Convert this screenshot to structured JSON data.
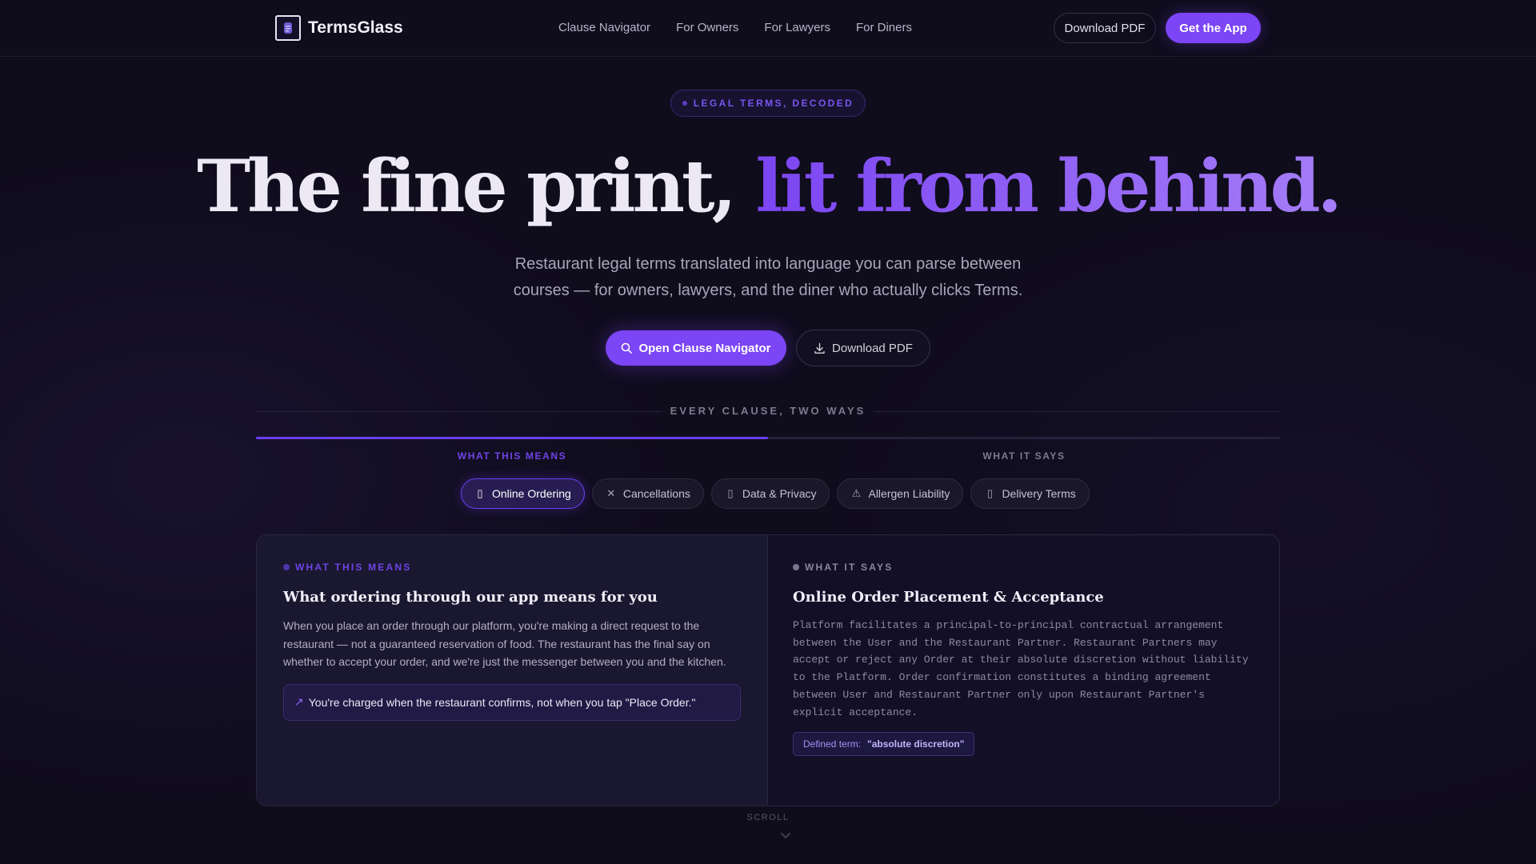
{
  "brand": {
    "name": "TermsGlass"
  },
  "nav": {
    "links": [
      "Clause Navigator",
      "For Owners",
      "For Lawyers",
      "For Diners"
    ],
    "download_label": "Download PDF",
    "get_app_label": "Get the App"
  },
  "hero": {
    "badge": "LEGAL TERMS, DECODED",
    "headline_plain": "The fine print, ",
    "headline_accent": "lit from behind.",
    "subtitle": "Restaurant legal terms translated into language you can parse between courses — for owners, lawyers, and the diner who actually clicks Terms.",
    "primary_cta": "Open Clause Navigator",
    "secondary_cta": "Download PDF"
  },
  "section": {
    "label": "EVERY CLAUSE, TWO WAYS",
    "progress": 0.5,
    "left_label": "WHAT THIS MEANS",
    "right_label": "WHAT IT SAYS"
  },
  "chips": [
    {
      "label": "Online Ordering",
      "icon": "receipt-icon",
      "active": true
    },
    {
      "label": "Cancellations",
      "icon": "close-icon",
      "active": false
    },
    {
      "label": "Data & Privacy",
      "icon": "lock-icon",
      "active": false
    },
    {
      "label": "Allergen Liability",
      "icon": "warning-icon",
      "active": false
    },
    {
      "label": "Delivery Terms",
      "icon": "truck-icon",
      "active": false
    }
  ],
  "panel": {
    "left": {
      "kicker": "WHAT THIS MEANS",
      "title": "What ordering through our app means for you",
      "body": "When you place an order through our platform, you're making a direct request to the restaurant — not a guaranteed reservation of food. The restaurant has the final say on whether to accept your order, and we're just the messenger between you and the kitchen.",
      "callout": "You're charged when the restaurant confirms, not when you tap \"Place Order.\""
    },
    "right": {
      "kicker": "WHAT IT SAYS",
      "title": "Online Order Placement & Acceptance",
      "body": "Platform facilitates a principal-to-principal contractual arrangement between the User and the Restaurant Partner. Restaurant Partners may accept or reject any Order at their absolute discretion without liability to the Platform. Order confirmation constitutes a binding agreement between User and Restaurant Partner only upon Restaurant Partner's explicit acceptance.",
      "defined_label": "Defined term:",
      "defined_value": "\"absolute discretion\""
    }
  },
  "scroll_hint": "SCROLL",
  "colors": {
    "accent": "#7c45f5",
    "accent_light": "#a57df7",
    "background": "#0f0c1c"
  }
}
